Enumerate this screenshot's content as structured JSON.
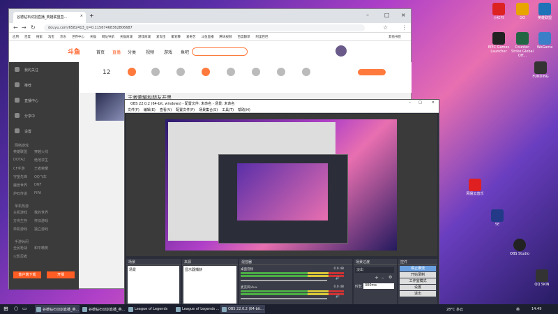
{
  "browser": {
    "tab_title": "谷德钻石切割直播_英雄联盟直...",
    "url": "douyu.com/6582413_rj=0.11567468362806687",
    "bookmarks": [
      "应用",
      "百度",
      "搜索",
      "淘宝",
      "京东",
      "世界中心",
      "天猫",
      "网址导航",
      "天猫商城",
      "游戏商城",
      "爱淘宝",
      "聚划算",
      "爱奇艺",
      "斗鱼直播",
      "腾讯视频",
      "百度翻译",
      "阿里巴巴",
      "其他书签"
    ],
    "logo": "斗鱼",
    "nav": [
      "首页",
      "直播",
      "分类",
      "视频",
      "游戏",
      "鱼吧"
    ],
    "nav_active": "直播",
    "sidebar_top": [
      "我的关注",
      "推荐",
      "直播中心",
      "分享中",
      "设置"
    ],
    "sidebar_sections": [
      {
        "title": "网络游戏",
        "items": [
          "英雄联盟",
          "穿越火线",
          "DOTA2",
          "绝地求生",
          "CF手游",
          "王者荣耀",
          "守望先锋",
          "QQ飞车",
          "魔兽世界",
          "DNF",
          "炉石传说",
          "FIFA"
        ]
      },
      {
        "title": "单机热游",
        "items": [
          "主机游戏",
          "我的世界",
          "方舟生存",
          "怀旧游戏",
          "单机游戏",
          "独立游戏"
        ]
      },
      {
        "title": "手游休闲",
        "items": [
          "全民枪战",
          "和平精英",
          "火影忍者"
        ]
      }
    ],
    "sidebar_button_left": "客户端下载",
    "sidebar_button_right": "开播",
    "stat_number": "12",
    "video_title": "王者荣耀和朋友开黑"
  },
  "obs": {
    "title": "OBS 22.0.2 (64-bit, windows) - 配置文件: 未命名 - 场景: 未命名",
    "menu": [
      "文件(F)",
      "编辑(E)",
      "查看(V)",
      "配置文件(P)",
      "场景集合(S)",
      "工具(T)",
      "帮助(H)"
    ],
    "docks": {
      "scenes": {
        "header": "场景",
        "items": [
          "场景"
        ]
      },
      "sources": {
        "header": "来源",
        "items": [
          "显示器捕获"
        ]
      },
      "mixer": {
        "header": "混音器",
        "rows": [
          {
            "name": "桌面音频",
            "db": "0.0 dB"
          },
          {
            "name": "麦克风/Aux",
            "db": "0.0 dB"
          }
        ]
      },
      "transitions": {
        "header": "场景过渡",
        "type": "淡出",
        "duration_label": "时长",
        "duration": "300ms"
      },
      "controls": {
        "header": "控件",
        "buttons": [
          "停止推流",
          "开始录制",
          "工作室模式",
          "设置",
          "退出"
        ]
      }
    }
  },
  "desktop_icons": [
    {
      "label": "小红书",
      "color": "#d22"
    },
    {
      "label": "GO",
      "color": "#e8a500"
    },
    {
      "label": "英雄联盟",
      "color": "#1e73b8"
    },
    {
      "label": "EPIC Games Launcher",
      "color": "#222"
    },
    {
      "label": "Counter-Strike Global Off...",
      "color": "#264"
    },
    {
      "label": "WeGame",
      "color": "#3a7fc8"
    },
    {
      "label": "FUNDING",
      "color": "#333"
    },
    {
      "label": "网易云音乐",
      "color": "#e02020"
    },
    {
      "label": "5E",
      "color": "#223a88"
    },
    {
      "label": "OBS Studio",
      "color": "#222"
    },
    {
      "label": "QQ SKIN",
      "color": "#333"
    }
  ],
  "taskbar": {
    "items": [
      "谷德钻石切割直播_英...",
      "谷德钻石切割直播_英...",
      "League of Legends",
      "League of Legends ...",
      "OBS 22.0.2 (64-bit..."
    ],
    "weather": "28°C 多云",
    "lang": "英",
    "time": "14:49"
  }
}
